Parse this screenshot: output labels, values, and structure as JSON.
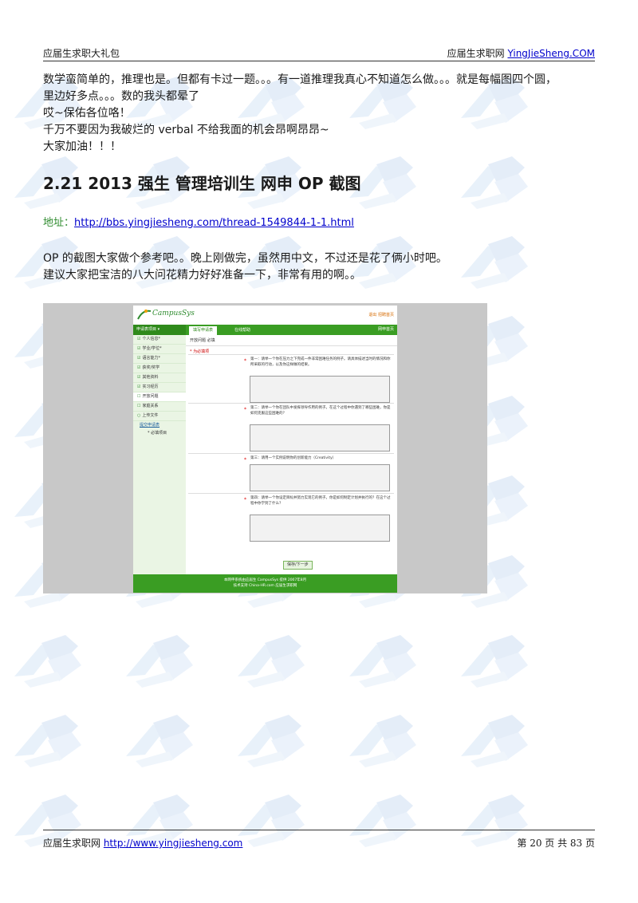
{
  "header": {
    "left_text": "应届生求职大礼包",
    "right_prefix": "应届生求职网 ",
    "right_link": "YingJieSheng.COM"
  },
  "paragraph1": {
    "lines": [
      "数学蛮简单的，推理也是。但都有卡过一题。。。有一道推理我真心不知道怎么做。。。就是每幅图四个圆，",
      "里边好多点。。。数的我头都晕了",
      "哎~保佑各位咯！",
      "千万不要因为我破烂的 verbal 不给我面的机会昂啊昂昂~",
      "大家加油！！！"
    ]
  },
  "section_heading": "2.21 2013 强生  管理培训生  网申  OP  截图",
  "address": {
    "label": "地址：",
    "url": "http://bbs.yingjiesheng.com/thread-1549844-1-1.html"
  },
  "paragraph2": {
    "lines": [
      "OP 的截图大家做个参考吧。。晚上刚做完，虽然用中文，不过还是花了俩小时吧。",
      "建议大家把宝洁的八大问花精力好好准备一下，非常有用的啊。。"
    ]
  },
  "screenshot": {
    "logo_text": "CampusSys",
    "top_links": "退出 招聘首页",
    "nav_side": "申请表项目 ▾",
    "tabs": [
      "填写申请表",
      "在线帮助"
    ],
    "nav_right": "网申首页",
    "sidebar_items": [
      {
        "mark": "☑",
        "label": "个人信息*"
      },
      {
        "mark": "☑",
        "label": "学业/学位*"
      },
      {
        "mark": "☑",
        "label": "语言能力*"
      },
      {
        "mark": "☑",
        "label": "获奖/奖学"
      },
      {
        "mark": "☑",
        "label": "其他资料"
      },
      {
        "mark": "☑",
        "label": "实习经历"
      },
      {
        "mark": "☐",
        "label": "开放问题"
      },
      {
        "mark": "☐",
        "label": "家庭关系"
      },
      {
        "mark": "○",
        "label": "上传文件"
      }
    ],
    "sidebar_sub": "提交申请表",
    "sidebar_sub2": "* 必填项目",
    "crumb": "开放问题 必填",
    "required_note": "* 为必填项",
    "questions": [
      "第一：请举一个你在压力之下完成一件非常困难任务的例子。请具体描述当时的情况和你所采取的行动，以及你这样做的结果。",
      "第二：请举一个你在团队中发挥领导作用的例子。在这个过程中你遇到了哪些困难，你是如何克服这些困难的？",
      "第三：请用一个实例说明你的创新能力（Creativity）",
      "第四：请举一个你设定目标并努力实现它的例子。你是如何制定计划并执行的？在这个过程中你学到了什么？"
    ],
    "submit_label": "保存/下一步",
    "footer_lines": [
      "本网申系统由应届生 CampusSys 提供 2007年8月",
      "技术支持 China-HR.com 应届生求职网"
    ]
  },
  "footer": {
    "left_prefix": "应届生求职网 ",
    "left_link": "http://www.yingjiesheng.com",
    "right_text": "第  20  页  共  83  页"
  }
}
